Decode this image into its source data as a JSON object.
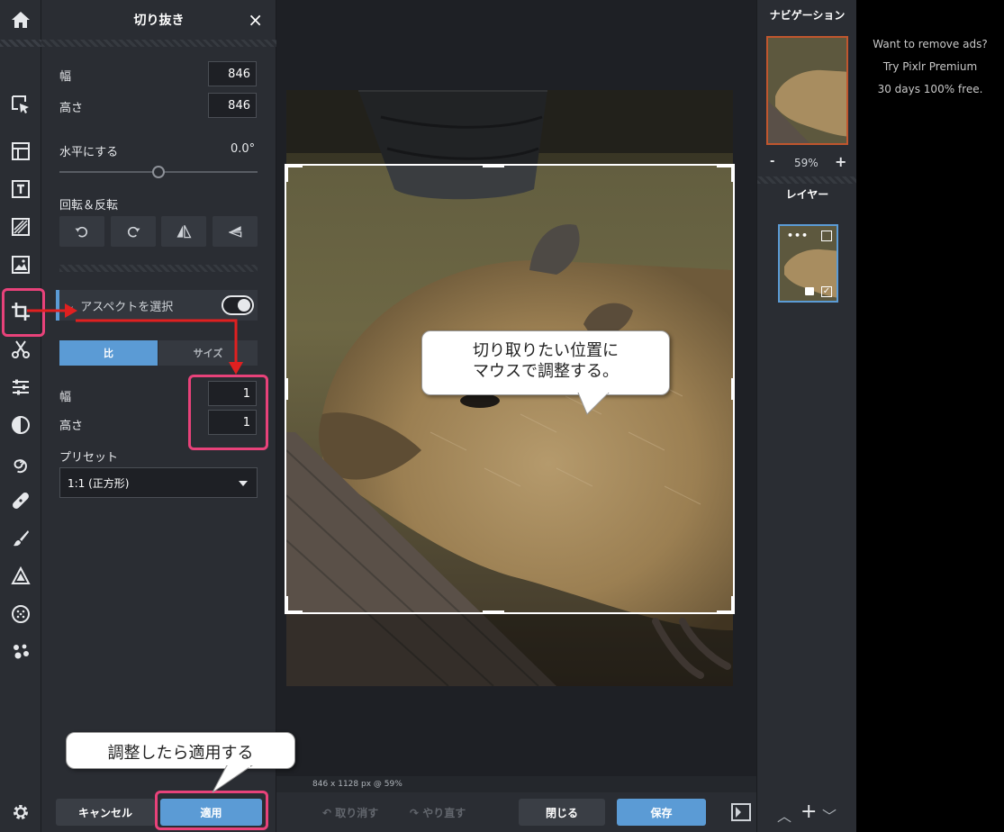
{
  "panel": {
    "title": "切り抜き",
    "close": "×",
    "width_label": "幅",
    "width_value": "846",
    "height_label": "高さ",
    "height_value": "846",
    "straighten_label": "水平にする",
    "straighten_value": "0.0°",
    "rotate_label": "回転＆反転",
    "aspect_label": "アスペクトを選択",
    "tab_ratio": "比",
    "tab_size": "サイズ",
    "ratio_width_label": "幅",
    "ratio_width_value": "1",
    "ratio_height_label": "高さ",
    "ratio_height_value": "1",
    "preset_label": "プリセット",
    "preset_value": "1:1 (正方形)",
    "cancel": "キャンセル",
    "apply": "適用"
  },
  "canvas": {
    "status": "846 x 1128 px @ 59%",
    "undo": "取り消す",
    "redo": "やり直す",
    "close": "閉じる",
    "save": "保存"
  },
  "navigator": {
    "title": "ナビゲーション",
    "zoom_minus": "-",
    "zoom": "59%",
    "zoom_plus": "+"
  },
  "layers": {
    "title": "レイヤー"
  },
  "ads": {
    "line1": "Want to remove ads?",
    "line2": "Try Pixlr Premium",
    "line3": "30 days 100% free."
  },
  "annotations": {
    "canvas_bubble_line1": "切り取りたい位置に",
    "canvas_bubble_line2": "マウスで調整する。",
    "apply_bubble": "調整したら適用する"
  },
  "colors": {
    "accent": "#5b9bd5",
    "highlight": "#e8427a",
    "arrow": "#e02020"
  }
}
